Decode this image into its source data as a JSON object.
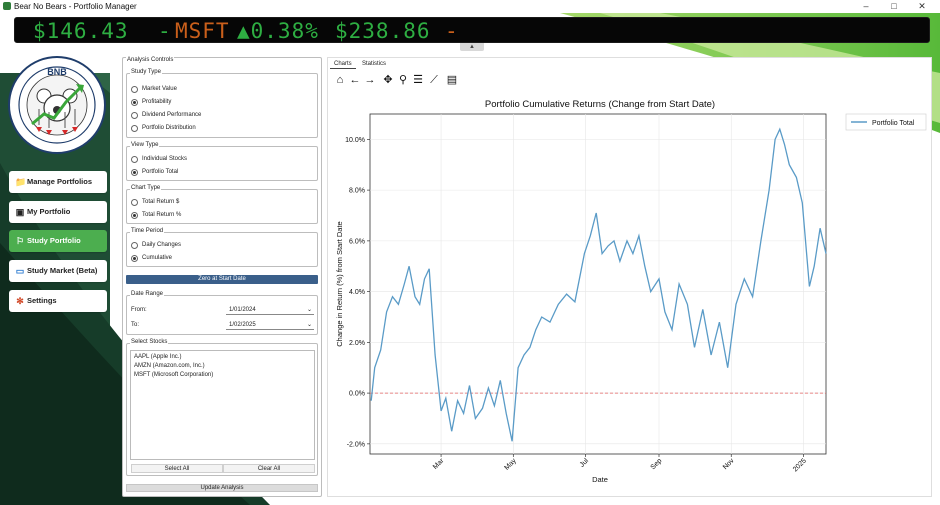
{
  "window": {
    "title": "Bear No Bears - Portfolio Manager",
    "controls": [
      "–",
      "□",
      "✕"
    ]
  },
  "ticker": {
    "segments": [
      {
        "text": "$146.43",
        "color": "green"
      },
      {
        "text": "-",
        "color": "green"
      },
      {
        "text": "MSFT",
        "color": "orange"
      },
      {
        "text": "▲0.38%",
        "color": "green"
      },
      {
        "text": "$238.86",
        "color": "green"
      },
      {
        "text": "-",
        "color": "orange"
      }
    ]
  },
  "logo": {
    "text": "BNB",
    "ring_text": "BEAR NO BEARS"
  },
  "nav": {
    "items": [
      {
        "label": "Manage Portfolios",
        "icon": "folder-icon"
      },
      {
        "label": "My Portfolio",
        "icon": "portfolio-icon"
      },
      {
        "label": "Study Portfolio",
        "icon": "study-icon",
        "active": true
      },
      {
        "label": "Study Market (Beta)",
        "icon": "monitor-icon"
      },
      {
        "label": "Settings",
        "icon": "gear-icon"
      }
    ]
  },
  "controls": {
    "title": "Analysis Controls",
    "study_type": {
      "title": "Study Type",
      "options": [
        "Market Value",
        "Profitability",
        "Dividend Performance",
        "Portfolio Distribution"
      ],
      "selected": 1
    },
    "view_type": {
      "title": "View Type",
      "options": [
        "Individual Stocks",
        "Portfolio Total"
      ],
      "selected": 1
    },
    "chart_type": {
      "title": "Chart Type",
      "options": [
        "Total Return $",
        "Total Return %"
      ],
      "selected": 1
    },
    "time_period": {
      "title": "Time Period",
      "options": [
        "Daily Changes",
        "Cumulative"
      ],
      "selected": 1
    },
    "zero_button": "Zero at Start Date",
    "date_range": {
      "title": "Date Range",
      "from_label": "From:",
      "from_value": "1/01/2024",
      "to_label": "To:",
      "to_value": "1/02/2025"
    },
    "select_stocks": {
      "title": "Select Stocks",
      "items": [
        "AAPL (Apple Inc.)",
        "AMZN (Amazon.com, Inc.)",
        "MSFT (Microsoft Corporation)"
      ],
      "select_all": "Select All",
      "clear_all": "Clear All"
    },
    "update_button": "Update Analysis"
  },
  "tabs": [
    {
      "label": "Charts",
      "active": true
    },
    {
      "label": "Statistics",
      "active": false
    }
  ],
  "toolbar": [
    "home-icon",
    "back-icon",
    "forward-icon",
    "pan-icon",
    "zoom-icon",
    "configure-icon",
    "axes-icon",
    "save-icon"
  ],
  "chart_data": {
    "type": "line",
    "title": "Portfolio Cumulative Returns (Change from Start Date)",
    "xlabel": "Date",
    "ylabel": "Change in Return (%) from Start Date",
    "ylim": [
      -2.4,
      11.0
    ],
    "xlim": [
      "2024-01-01",
      "2025-01-20"
    ],
    "yticks": [
      -2.0,
      0.0,
      2.0,
      4.0,
      6.0,
      8.0,
      10.0
    ],
    "ytick_labels": [
      "-2.0%",
      "0.0%",
      "2.0%",
      "4.0%",
      "6.0%",
      "8.0%",
      "10.0%"
    ],
    "xticks": [
      "2024-03-01",
      "2024-05-01",
      "2024-07-01",
      "2024-09-01",
      "2024-11-01",
      "2025-01-01"
    ],
    "xtick_labels": [
      "Mar",
      "May",
      "Jul",
      "Sep",
      "Nov",
      "2025"
    ],
    "grid": true,
    "legend": "top-right-outside",
    "reference_line": {
      "y": 0,
      "color": "#e06060",
      "style": "dashed"
    },
    "colors": {
      "line": "#5a9bc7"
    },
    "series": [
      {
        "name": "Portfolio Total",
        "x": [
          "2024-01-02",
          "2024-01-05",
          "2024-01-10",
          "2024-01-15",
          "2024-01-20",
          "2024-01-25",
          "2024-01-30",
          "2024-02-03",
          "2024-02-08",
          "2024-02-12",
          "2024-02-16",
          "2024-02-20",
          "2024-02-25",
          "2024-03-01",
          "2024-03-05",
          "2024-03-10",
          "2024-03-15",
          "2024-03-20",
          "2024-03-25",
          "2024-03-30",
          "2024-04-05",
          "2024-04-10",
          "2024-04-15",
          "2024-04-20",
          "2024-04-25",
          "2024-04-30",
          "2024-05-05",
          "2024-05-10",
          "2024-05-15",
          "2024-05-20",
          "2024-05-25",
          "2024-06-01",
          "2024-06-08",
          "2024-06-15",
          "2024-06-22",
          "2024-06-30",
          "2024-07-05",
          "2024-07-10",
          "2024-07-15",
          "2024-07-20",
          "2024-07-25",
          "2024-07-30",
          "2024-08-05",
          "2024-08-10",
          "2024-08-15",
          "2024-08-20",
          "2024-08-25",
          "2024-09-01",
          "2024-09-06",
          "2024-09-12",
          "2024-09-18",
          "2024-09-25",
          "2024-10-01",
          "2024-10-08",
          "2024-10-15",
          "2024-10-22",
          "2024-10-29",
          "2024-11-05",
          "2024-11-12",
          "2024-11-19",
          "2024-11-26",
          "2024-12-03",
          "2024-12-08",
          "2024-12-12",
          "2024-12-16",
          "2024-12-20",
          "2024-12-26",
          "2024-12-31",
          "2025-01-06",
          "2025-01-10",
          "2025-01-15",
          "2025-01-20"
        ],
        "y": [
          -0.3,
          1.0,
          1.7,
          3.2,
          3.8,
          3.5,
          4.3,
          5.0,
          3.8,
          3.5,
          4.5,
          4.9,
          1.5,
          -0.7,
          -0.2,
          -1.5,
          -0.3,
          -0.8,
          0.3,
          -1.0,
          -0.6,
          0.2,
          -0.5,
          0.5,
          -0.8,
          -1.9,
          1.0,
          1.5,
          1.8,
          2.5,
          3.0,
          2.8,
          3.5,
          3.9,
          3.6,
          5.5,
          6.2,
          7.1,
          5.5,
          5.8,
          6.0,
          5.2,
          6.0,
          5.5,
          6.2,
          5.0,
          4.0,
          4.5,
          3.2,
          2.5,
          4.3,
          3.5,
          1.8,
          3.3,
          1.5,
          2.8,
          1.0,
          3.5,
          4.5,
          3.8,
          6.0,
          8.0,
          10.0,
          10.4,
          9.8,
          9.0,
          8.5,
          7.5,
          4.2,
          5.0,
          6.5,
          5.5
        ]
      }
    ]
  }
}
